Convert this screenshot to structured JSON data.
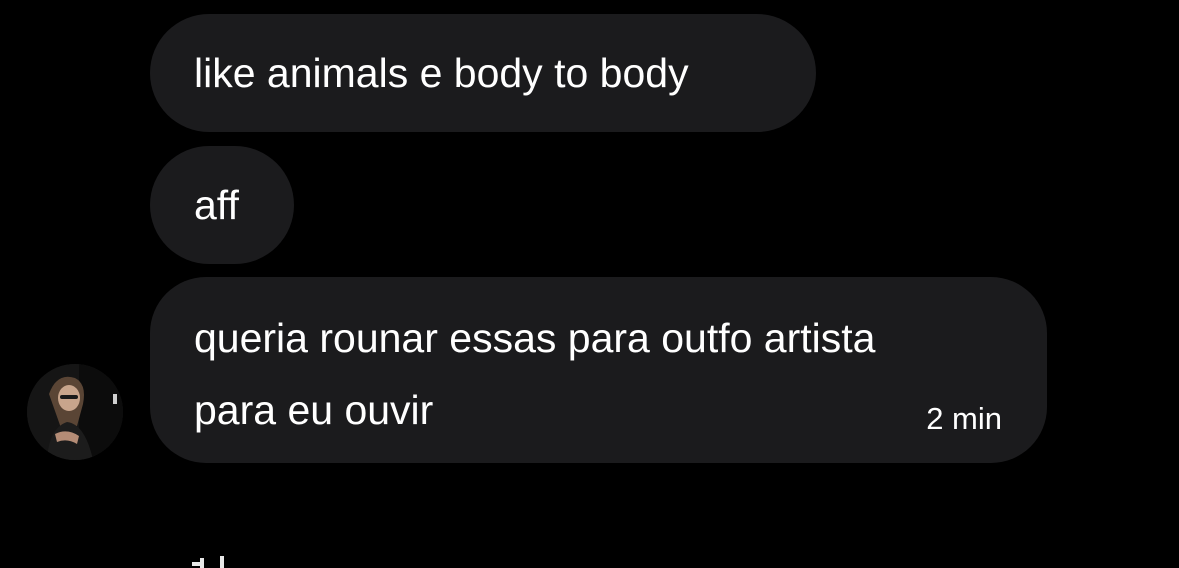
{
  "messages": [
    {
      "text": "like animals e body to body"
    },
    {
      "text": "aff"
    },
    {
      "lines": [
        "queria rounar essas para outfo artista",
        "para eu ouvir"
      ],
      "timestamp": "2 min"
    }
  ],
  "avatar": {
    "icon": "user-avatar-photo"
  },
  "colors": {
    "background": "#000000",
    "bubble": "#1b1b1d",
    "text": "#ffffff"
  }
}
